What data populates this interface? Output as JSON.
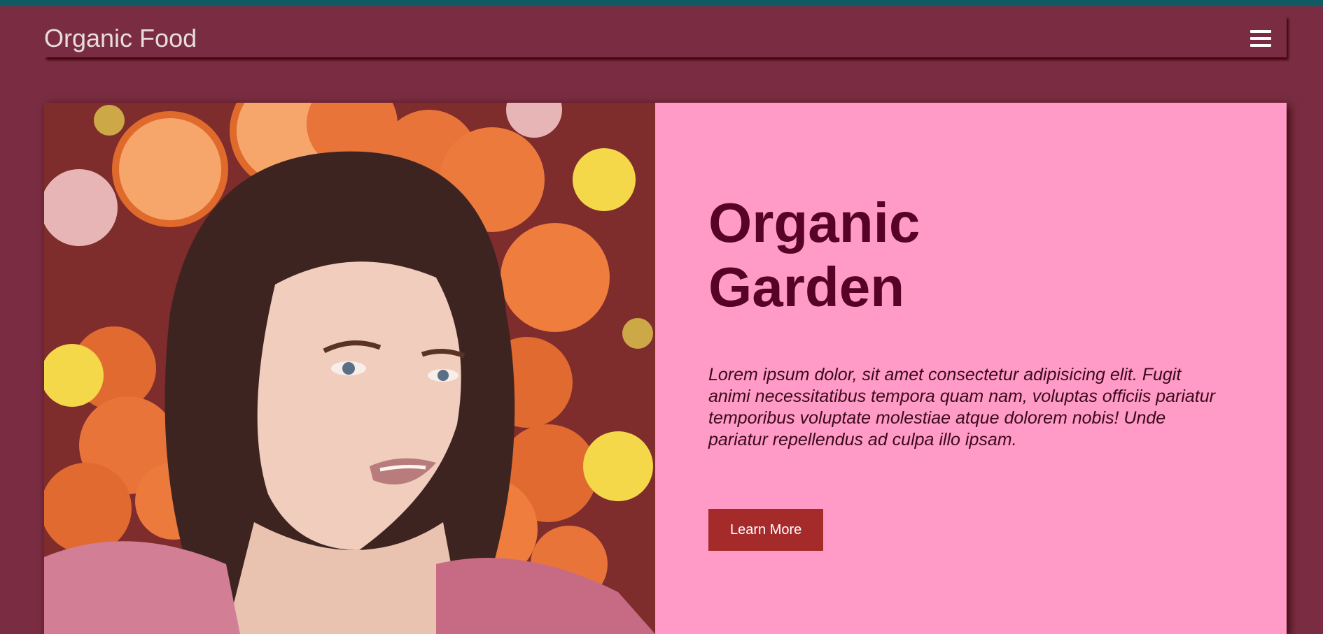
{
  "header": {
    "brand": "Organic Food",
    "menu_icon": "hamburger-menu-icon"
  },
  "hero": {
    "title": "Organic Garden",
    "description": "Lorem ipsum dolor, sit amet consectetur adipisicing elit. Fugit animi necessitatibus tempora quam nam, voluptas officiis pariatur temporibus voluptate molestiae atque dolorem nobis! Unde pariatur repellendus ad culpa illo ipsam.",
    "cta_label": "Learn More"
  },
  "colors": {
    "page_background": "#7a2d42",
    "top_strip": "#0f5a63",
    "panel_background": "#ff9bc6",
    "title_color": "#560327",
    "button_background": "#a52a2a"
  }
}
